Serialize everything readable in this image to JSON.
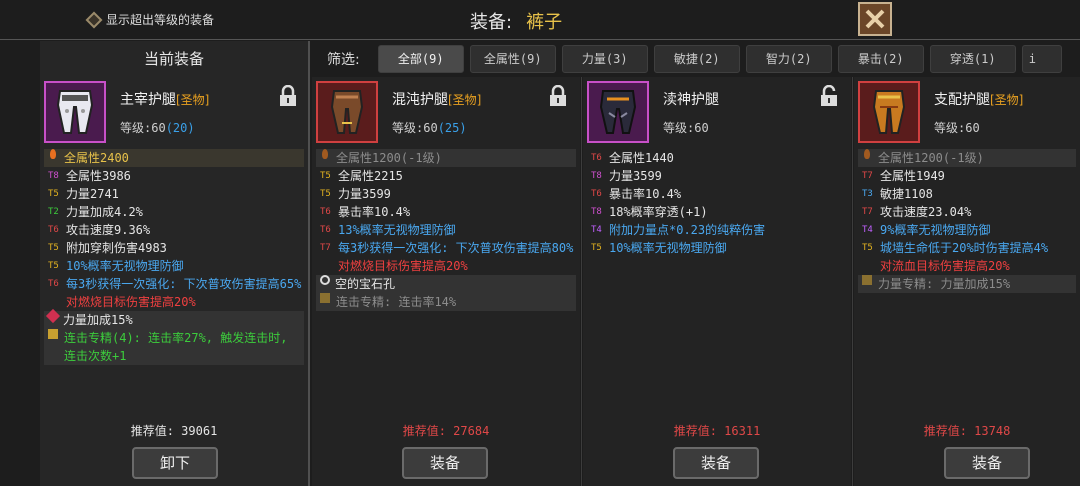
{
  "top": {
    "show_over_level": "显示超出等级的装备",
    "title_label": "装备:",
    "title_value": "裤子"
  },
  "current": {
    "header": "当前装备",
    "name": "主宰护腿",
    "quality": "[圣物]",
    "level_label": "等级:60",
    "level_bonus": "(20)",
    "base": "全属性2400",
    "stats": [
      {
        "tier": "T8",
        "text": "全属性3986"
      },
      {
        "tier": "T5",
        "text": "力量2741"
      },
      {
        "tier": "T2",
        "text": "力量加成4.2%"
      },
      {
        "tier": "T6",
        "text": "攻击速度9.36%"
      },
      {
        "tier": "T5",
        "text": "附加穿刺伤害4983"
      },
      {
        "tier": "T5",
        "text": "10%概率无视物理防御"
      },
      {
        "tier": "T6",
        "text": "每3秒获得一次强化: 下次普攻伤害提高65%"
      },
      {
        "tier": "",
        "text": "对燃烧目标伤害提高20%"
      }
    ],
    "gem": "力量加成15%",
    "mastery": "连击专精(4): 连击率27%, 触发连击时, 连击次数+1",
    "rec_label": "推荐值:",
    "rec_value": "39061",
    "button": "卸下"
  },
  "filter": {
    "label": "筛选:",
    "tabs": [
      "全部(9)",
      "全属性(9)",
      "力量(3)",
      "敏捷(2)",
      "智力(2)",
      "暴击(2)",
      "穿透(1)",
      "i"
    ]
  },
  "items": [
    {
      "name": "混沌护腿",
      "quality": "[圣物]",
      "level_label": "等级:60",
      "level_bonus": "(25)",
      "base": "全属性1200(-1级)",
      "stats": [
        {
          "tier": "T5",
          "text": "全属性2215"
        },
        {
          "tier": "T5",
          "text": "力量3599"
        },
        {
          "tier": "T6",
          "text": "暴击率10.4%"
        },
        {
          "tier": "T6",
          "text": "13%概率无视物理防御"
        },
        {
          "tier": "T7",
          "text": "每3秒获得一次强化: 下次普攻伤害提高80%"
        },
        {
          "tier": "",
          "text": "对燃烧目标伤害提高20%"
        }
      ],
      "socket": "空的宝石孔",
      "mastery": "连击专精: 连击率14%",
      "rec_label": "推荐值:",
      "rec_value": "27684",
      "button": "装备"
    },
    {
      "name": "渎神护腿",
      "quality": "",
      "level_label": "等级:60",
      "level_bonus": "",
      "stats": [
        {
          "tier": "T6",
          "text": "全属性1440"
        },
        {
          "tier": "T8",
          "text": "力量3599"
        },
        {
          "tier": "T6",
          "text": "暴击率10.4%"
        },
        {
          "tier": "T8",
          "text": "18%概率穿透(+1)"
        },
        {
          "tier": "T4",
          "text": "附加力量点*0.23的纯粹伤害"
        },
        {
          "tier": "T5",
          "text": "10%概率无视物理防御"
        }
      ],
      "rec_label": "推荐值:",
      "rec_value": "16311",
      "button": "装备"
    },
    {
      "name": "支配护腿",
      "quality": "[圣物]",
      "level_label": "等级:60",
      "level_bonus": "",
      "base": "全属性1200(-1级)",
      "stats": [
        {
          "tier": "T7",
          "text": "全属性1949"
        },
        {
          "tier": "T3",
          "text": "敏捷1108"
        },
        {
          "tier": "T7",
          "text": "攻击速度23.04%"
        },
        {
          "tier": "T4",
          "text": "9%概率无视物理防御"
        },
        {
          "tier": "T5",
          "text": "城墙生命低于20%时伤害提高4%"
        },
        {
          "tier": "",
          "text": "对流血目标伤害提高20%"
        }
      ],
      "mastery": "力量专精: 力量加成15%",
      "rec_label": "推荐值:",
      "rec_value": "13748",
      "button": "装备"
    }
  ]
}
